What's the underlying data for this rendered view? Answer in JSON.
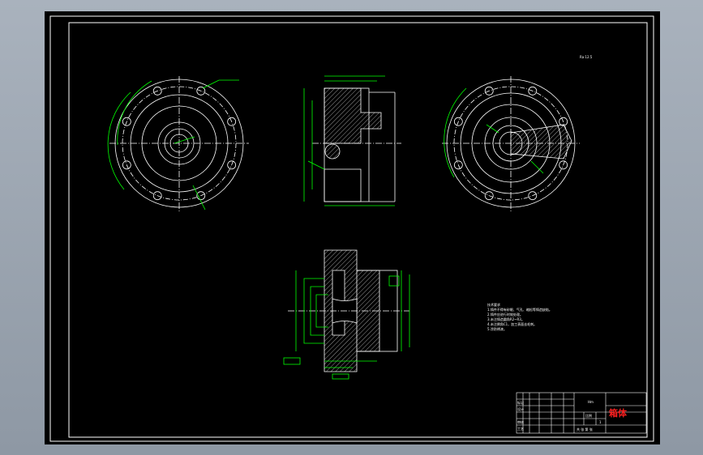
{
  "title_block": {
    "part_name": "箱体",
    "material": "Hm",
    "row_labels": [
      "标记",
      "设计",
      "审核",
      "工艺"
    ],
    "scale_label": "比例",
    "quantity_value": "1",
    "sheet_label": "共  张  第  张"
  },
  "notes": {
    "heading": "技术要求",
    "lines": [
      "1.铸件不得有砂眼、气孔、缩松等铸造缺陷。",
      "2.铸件应进行时效处理。",
      "3.未注铸造圆角R2~R3。",
      "4.未注倒角C1，加工表面去毛刺。",
      "5.涂防锈漆。"
    ]
  },
  "roughness_label": "Ra 12.5",
  "colors": {
    "outline": "#ffffff",
    "dimension": "#00ff00",
    "title_red": "#ff2020",
    "background": "#000000"
  }
}
